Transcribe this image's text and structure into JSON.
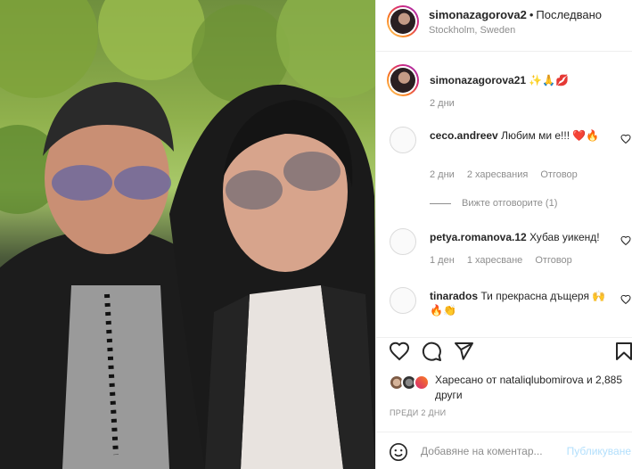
{
  "post": {
    "author": "simonazagorova2",
    "follow_status": "Последвано",
    "location": "Stockholm, Sweden"
  },
  "caption": {
    "username": "simonazagorova21",
    "emojis": "✨🙏💋",
    "time": "2 дни"
  },
  "comments": [
    {
      "username": "ceco.andreev",
      "text": "Любим ми е!!! ❤️🔥",
      "time": "2 дни",
      "likes": "2 харесвания",
      "reply": "Отговор",
      "view_replies": "Вижте отговорите (1)"
    },
    {
      "username": "petya.romanova.12",
      "text": "Хубав уикенд!",
      "time": "1 ден",
      "likes": "1 харесване",
      "reply": "Отговор"
    },
    {
      "username": "tinarados",
      "text": "Ти прекрасна дъщеря 🙌🔥👏",
      "time": "",
      "likes": "",
      "reply": ""
    }
  ],
  "likes": {
    "text": "Харесано от nataliqlubomirova и 2,885 други"
  },
  "date_label": "ПРЕДИ 2 ДНИ",
  "add_comment": {
    "placeholder": "Добавяне на коментар...",
    "post_label": "Публикуване"
  },
  "icons": [
    "heart-icon",
    "comment-icon",
    "share-icon",
    "bookmark-icon",
    "emoji-icon"
  ],
  "colors": {
    "post_button": "#b2dffc",
    "heart": "#ed4956",
    "text": "#262626",
    "muted": "#8e8e8e"
  }
}
